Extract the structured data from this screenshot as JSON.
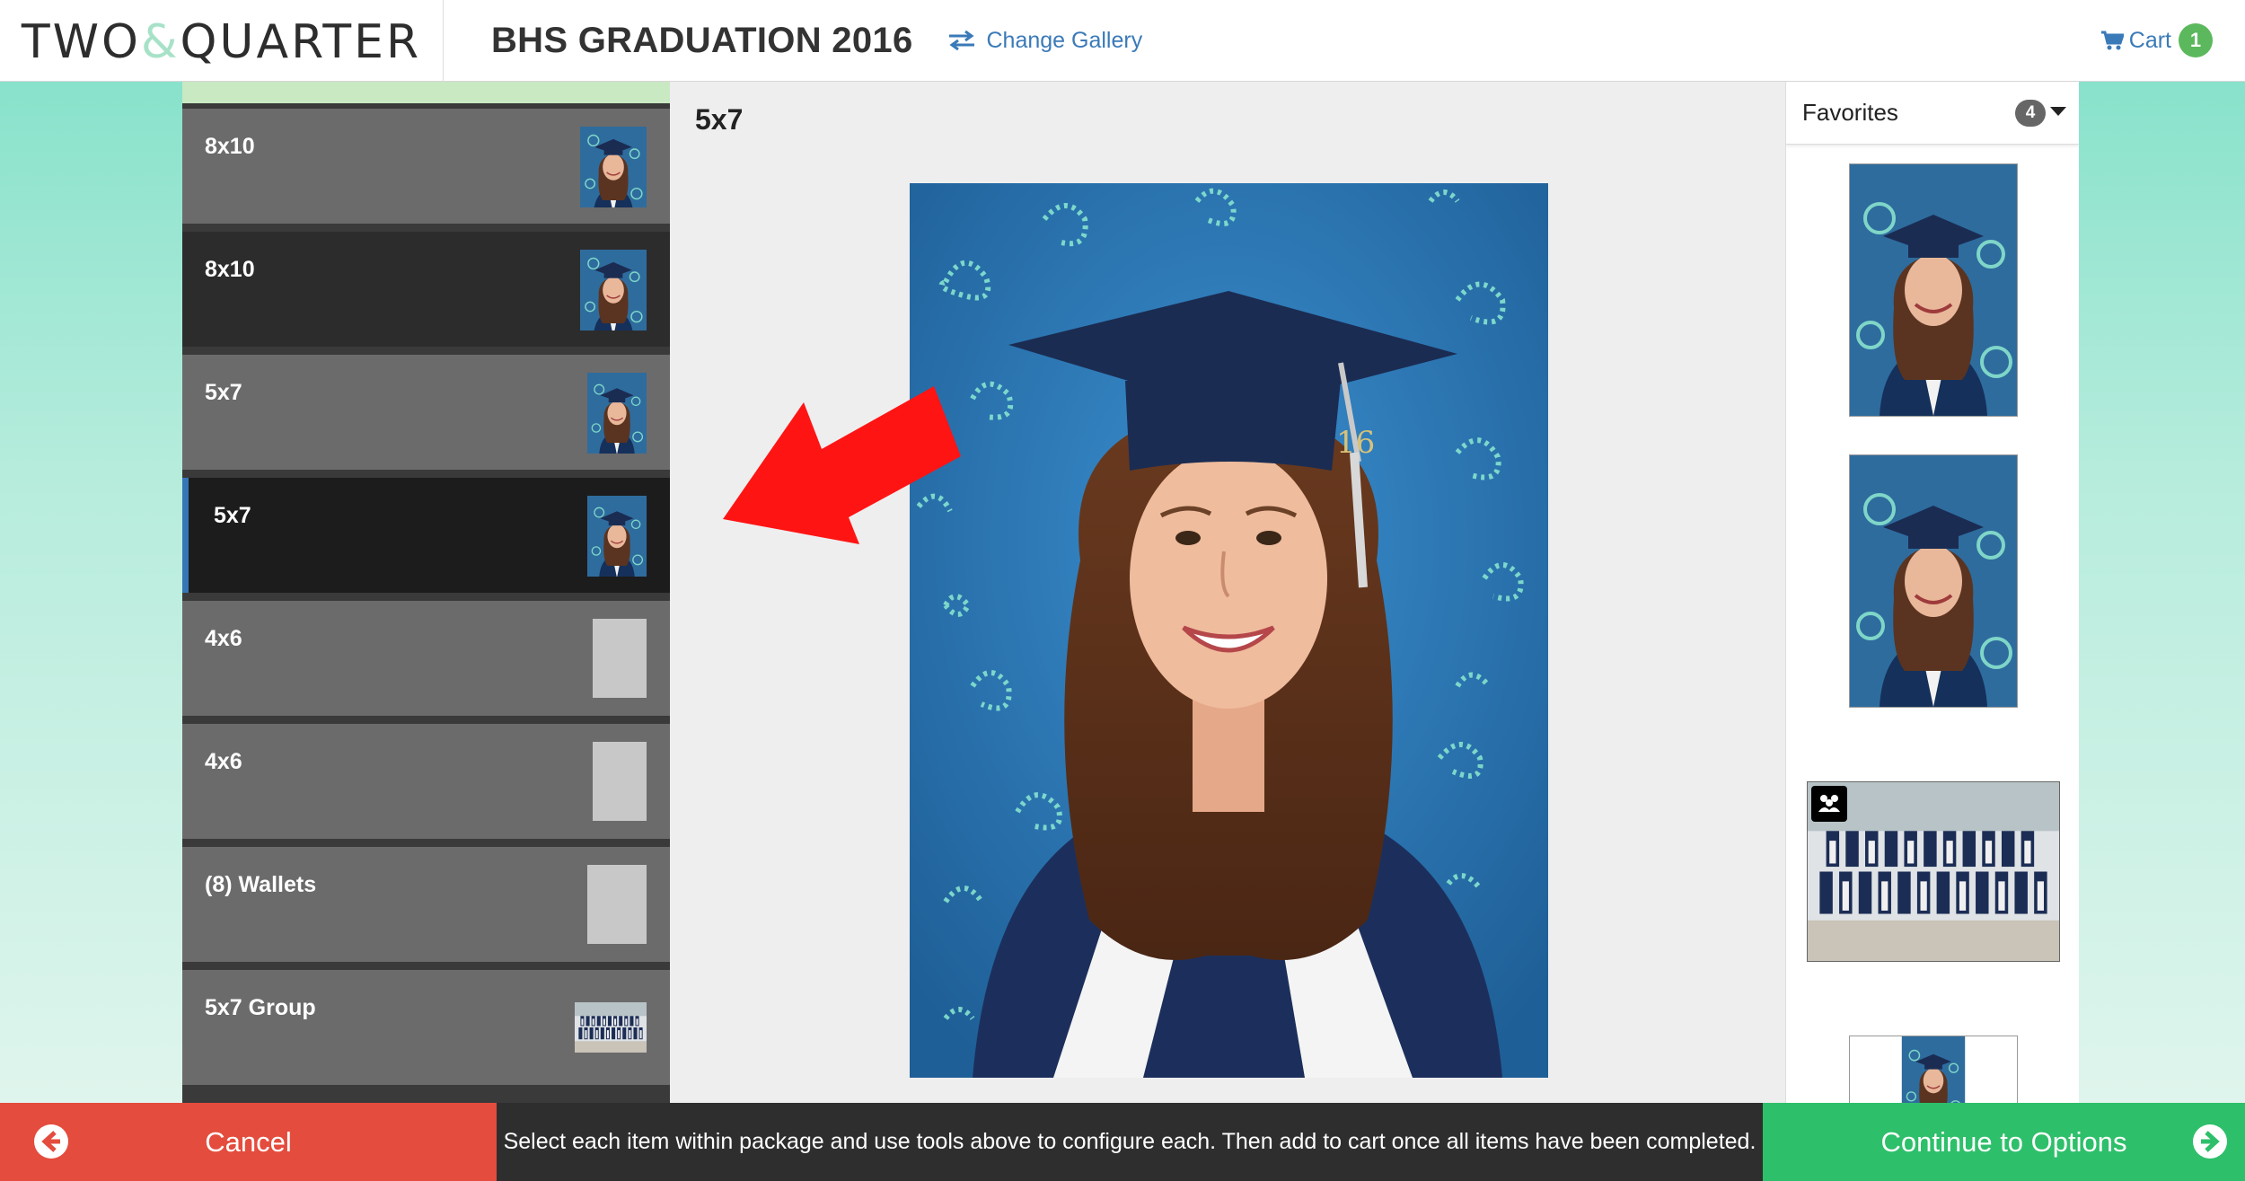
{
  "header": {
    "logo_left": "TWO",
    "logo_amp": "&",
    "logo_right": "QUARTER",
    "gallery_title": "BHS GRADUATION 2016",
    "change_gallery_label": "Change Gallery",
    "cart_label": "Cart",
    "cart_count": "1"
  },
  "sidebar": {
    "items": [
      {
        "label": "8x10",
        "state": "default",
        "thumb": "portrait"
      },
      {
        "label": "8x10",
        "state": "dark",
        "thumb": "portrait"
      },
      {
        "label": "5x7",
        "state": "default",
        "thumb": "portrait"
      },
      {
        "label": "5x7",
        "state": "active",
        "thumb": "portrait"
      },
      {
        "label": "4x6",
        "state": "default",
        "thumb": "blank"
      },
      {
        "label": "4x6",
        "state": "default",
        "thumb": "blank"
      },
      {
        "label": "(8) Wallets",
        "state": "default",
        "thumb": "blank"
      },
      {
        "label": "5x7 Group",
        "state": "default",
        "thumb": "group"
      }
    ]
  },
  "main": {
    "title": "5x7"
  },
  "favorites": {
    "label": "Favorites",
    "count": "4"
  },
  "footer": {
    "cancel_label": "Cancel",
    "instructions": "Select each item within package and use tools above to configure each. Then add to cart once all items have been completed.",
    "continue_label": "Continue to Options"
  },
  "colors": {
    "cancel": "#e44c3d",
    "continue": "#2ebf6a",
    "link": "#3a7ab8",
    "active_accent": "#3576b6",
    "cart_badge": "#5cb85c"
  }
}
